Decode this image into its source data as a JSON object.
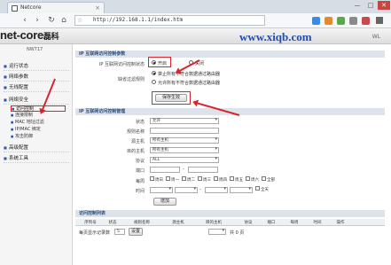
{
  "browser": {
    "tab_title": "Netcore",
    "tab_close": "×",
    "url": "http://192.168.1.1/index.htm",
    "win_min": "—",
    "win_max": "□",
    "win_close": "✕",
    "nav_back": "‹",
    "nav_forward": "›",
    "nav_reload": "↻",
    "nav_home": "⌂"
  },
  "header": {
    "logo": "net-core",
    "logo_cn": "磊科",
    "watermark": "www.xiqb.com",
    "right_text": "WL"
  },
  "sidebar": {
    "model": "NW717",
    "items": [
      {
        "label": "运行状态"
      },
      {
        "label": "网络参数"
      },
      {
        "label": "无线配置"
      },
      {
        "label": "网络安全"
      }
    ],
    "sub_items": [
      {
        "label": "访问控制"
      },
      {
        "label": "连接限制"
      },
      {
        "label": "MAC 地址过滤"
      },
      {
        "label": "IP/MAC 绑定"
      },
      {
        "label": "攻击防御"
      }
    ],
    "more_items": [
      {
        "label": "高级配置"
      },
      {
        "label": "系统工具"
      }
    ]
  },
  "section1": {
    "title": "IP 互联网访问控制参数",
    "switch_label": "IP 互联网访问控制状态",
    "on_label": "开启",
    "off_label": "关闭",
    "default_label": "缺省过滤规则",
    "rule_allow": "禁止所有不符合数据通过路由器",
    "rule_deny": "允许所有不符合数据通过路由器",
    "save_button": "保存生效"
  },
  "section2": {
    "title": "IP 互联网访问控制管理",
    "status_label": "状态",
    "status_value": "允许",
    "rule_name_label": "规则名称",
    "rule_name_value": "",
    "src_host_label": "源主机",
    "src_host_value": "所有主机",
    "dst_host_label": "目的主机",
    "dst_host_value": "所有主机",
    "protocol_label": "协议",
    "protocol_value": "ALL",
    "port_label": "端口",
    "port_sep": "-",
    "week_label": "每周",
    "days": [
      "周日",
      "周一",
      "周二",
      "周三",
      "周四",
      "周五",
      "周六",
      "全部"
    ],
    "time_label": "时间",
    "time_sep": "-",
    "all_day": "全天",
    "add_button": "增加"
  },
  "section3": {
    "title": "访问控制列表",
    "columns": [
      "序列号",
      "状态",
      "规则名称",
      "源主机",
      "目的主机",
      "协议",
      "端口",
      "每周",
      "时间",
      "操作"
    ],
    "per_page_label": "每页显示记录数",
    "per_page_value": "5",
    "set_button": "设置",
    "total_text": "共 0 页"
  }
}
